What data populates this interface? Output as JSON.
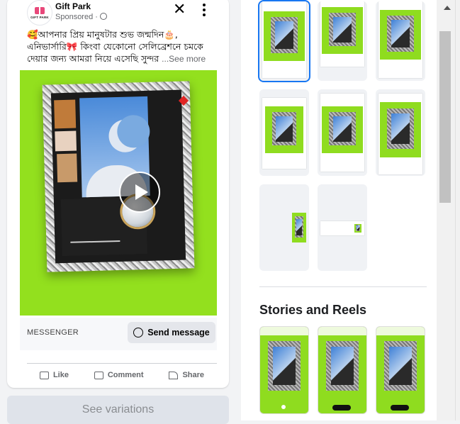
{
  "post": {
    "page_name": "Gift Park",
    "logo_text": "GIFT PARK",
    "sponsored": "Sponsored ·",
    "caption": "🥰আপনার প্রিয় মানুষটার শুভ জন্মদিন🎂, এনিভার্সারি🎀 কিংবা যেকোনো সেলিব্রেশনে চমকে দেয়ার জন্য আমরা নিয়ে এসেছি সুন্দর",
    "see_more": "...See more",
    "cta_label": "MESSENGER",
    "cta_button": "Send message",
    "actions": [
      "Like",
      "Comment",
      "Share"
    ]
  },
  "see_variations": "See variations",
  "right_panel": {
    "section_title": "Stories and Reels"
  },
  "colors": {
    "accent": "#1877f2",
    "media_green": "#93e01e"
  }
}
